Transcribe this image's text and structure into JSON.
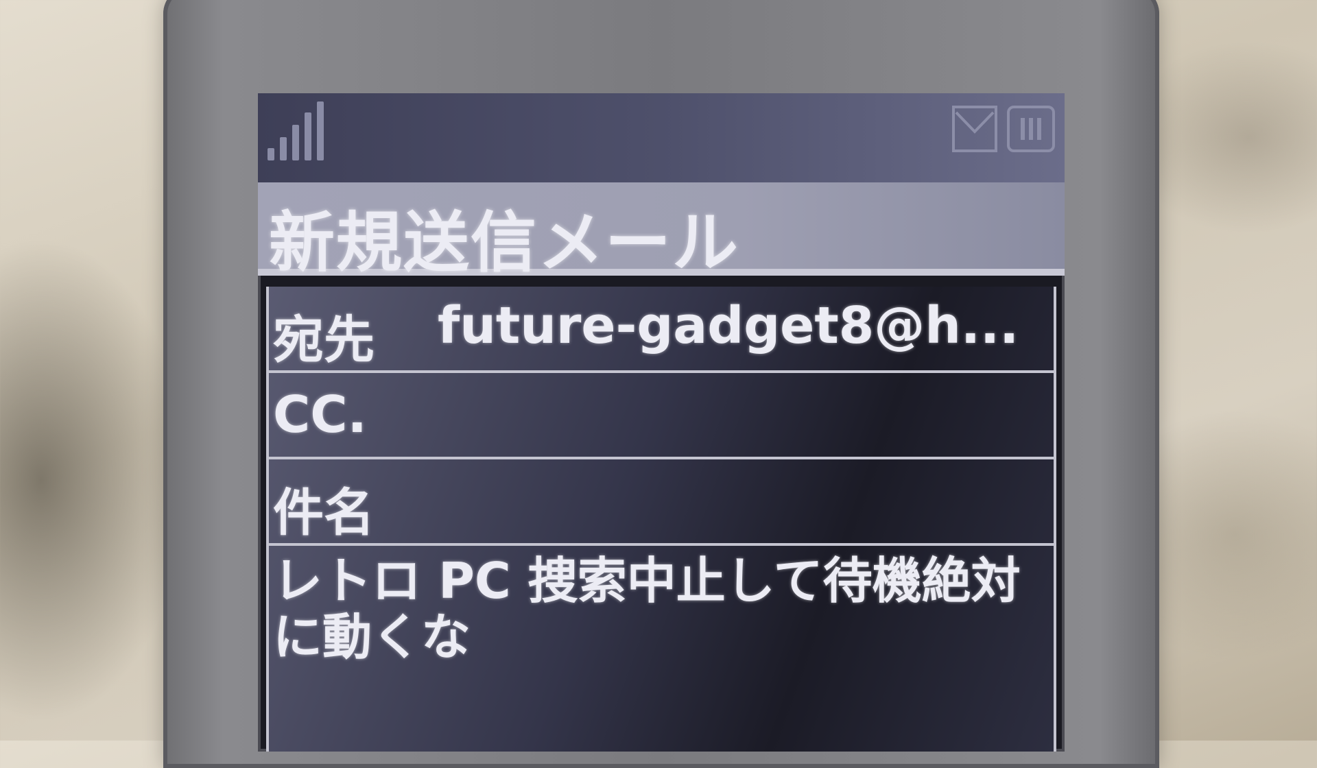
{
  "status_bar": {
    "signal_icon": "signal-strength-icon",
    "mail_icon": "mail-envelope-icon",
    "battery_icon": "battery-icon"
  },
  "title": "新規送信メール",
  "fields": {
    "to_label": "宛先",
    "to_value": "future-gadget8@h...",
    "cc_label": "CC.",
    "subject_label": "件名"
  },
  "body": "レトロ PC 捜索中止して待機絶対に動くな",
  "colors": {
    "screen_bg": "#1a1a22",
    "title_bar": "#a2a3b6",
    "text": "#ececf4",
    "phone_body": "#7b7b7f"
  }
}
